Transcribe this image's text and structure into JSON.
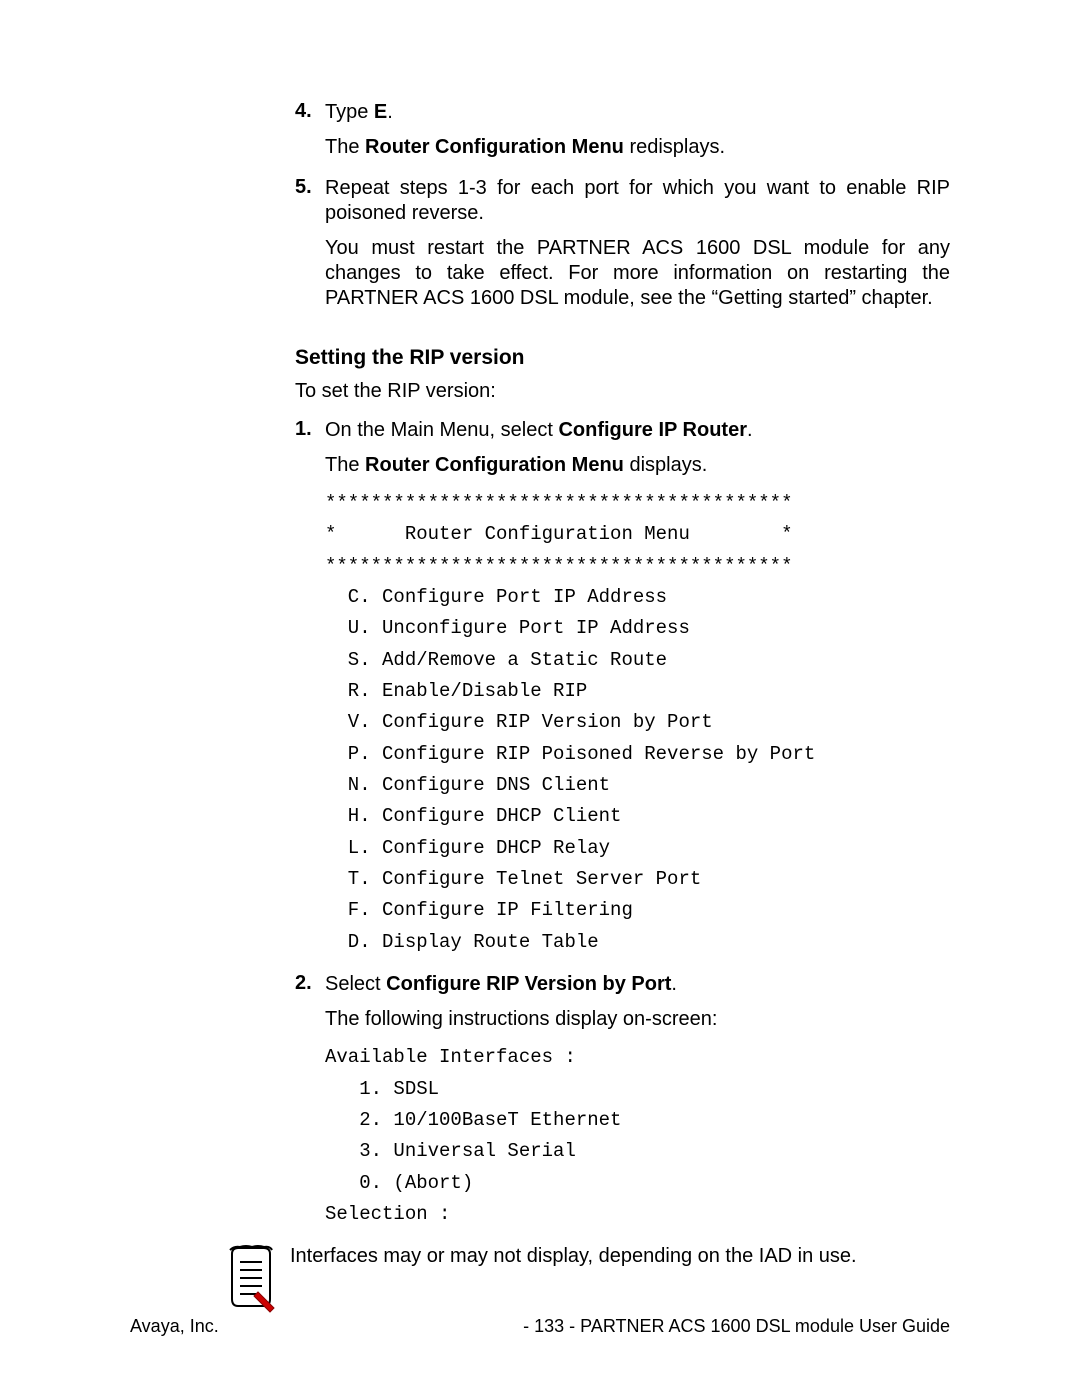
{
  "steps_a": {
    "s4": {
      "num": "4.",
      "l1_pre": "Type ",
      "l1_bold": "E",
      "l1_post": ".",
      "l2_pre": "The ",
      "l2_bold": "Router Configuration Menu",
      "l2_post": " redisplays."
    },
    "s5": {
      "num": "5.",
      "l1": "Repeat steps 1-3 for each port for which you want to enable RIP poisoned reverse.",
      "l2": "You must restart the PARTNER ACS 1600 DSL module for any changes to take effect.  For more information on restarting the PARTNER ACS 1600 DSL module, see the “Getting started” chapter."
    }
  },
  "heading": "Setting the RIP version",
  "intro": "To set the RIP version:",
  "steps_b": {
    "s1": {
      "num": "1.",
      "l1_pre": "On the Main Menu, select ",
      "l1_bold": "Configure IP Router",
      "l1_post": ".",
      "l2_pre": "The ",
      "l2_bold": "Router Configuration Menu",
      "l2_post": " displays."
    },
    "s2": {
      "num": "2.",
      "l1_pre": "Select ",
      "l1_bold": "Configure RIP Version by Port",
      "l1_post": ".",
      "l2": "The following instructions display on-screen:"
    }
  },
  "menu_block": "*****************************************\n*      Router Configuration Menu        *\n*****************************************\n  C. Configure Port IP Address\n  U. Unconfigure Port IP Address\n  S. Add/Remove a Static Route\n  R. Enable/Disable RIP\n  V. Configure RIP Version by Port\n  P. Configure RIP Poisoned Reverse by Port\n  N. Configure DNS Client\n  H. Configure DHCP Client\n  L. Configure DHCP Relay\n  T. Configure Telnet Server Port\n  F. Configure IP Filtering\n  D. Display Route Table",
  "interfaces_block": "Available Interfaces :\n   1. SDSL\n   2. 10/100BaseT Ethernet\n   3. Universal Serial\n   0. (Abort)\nSelection :",
  "note_text": "Interfaces may or may not display, depending on the IAD in use.",
  "footer": {
    "left": "Avaya, Inc.",
    "right": "- 133 - PARTNER ACS 1600 DSL module User Guide"
  }
}
